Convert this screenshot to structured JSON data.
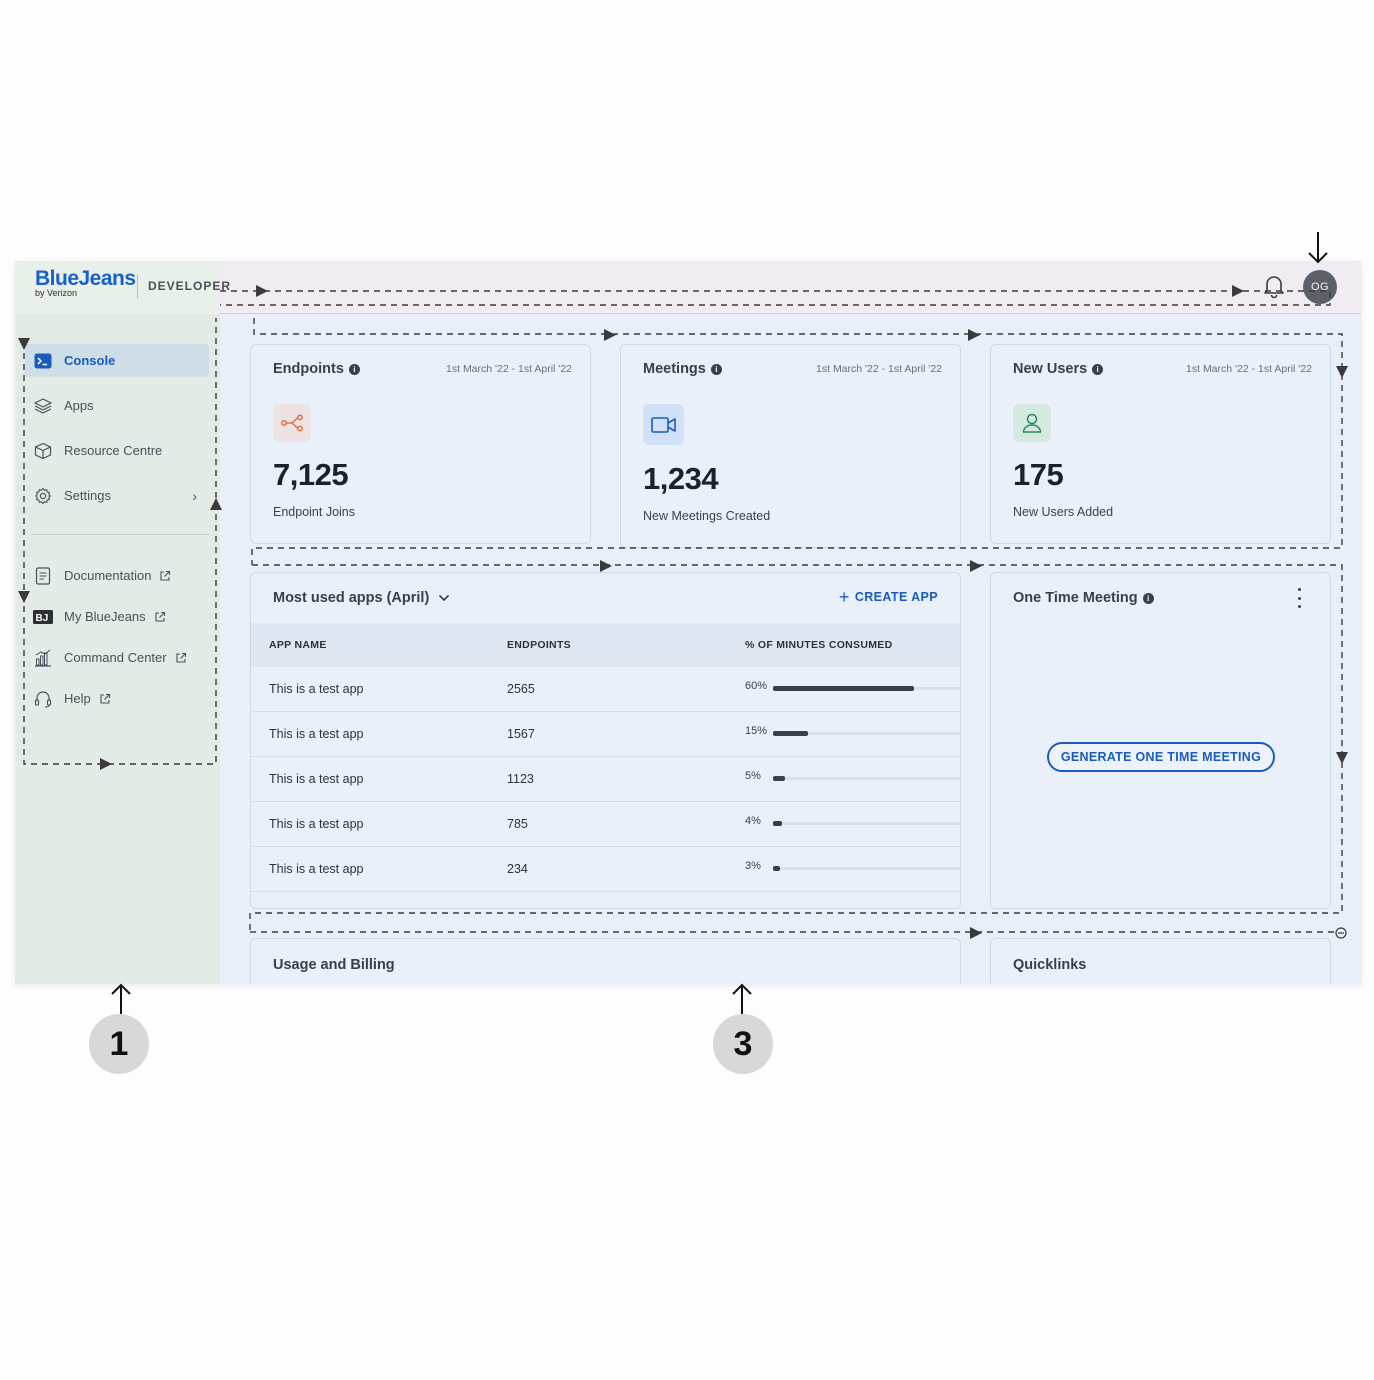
{
  "header": {
    "logo_main": "BlueJeans",
    "logo_sub": "by Verizon",
    "product_tag": "DEVELOPER",
    "avatar_initials": "OG"
  },
  "sidebar": {
    "items": [
      {
        "label": "Console",
        "icon": "console-icon",
        "active": true
      },
      {
        "label": "Apps",
        "icon": "layers-icon"
      },
      {
        "label": "Resource Centre",
        "icon": "box-icon"
      },
      {
        "label": "Settings",
        "icon": "gear-icon",
        "chevron": true
      }
    ],
    "links": [
      {
        "label": "Documentation",
        "icon": "document-icon"
      },
      {
        "label": "My BlueJeans",
        "icon": "bluejeans-logo-icon"
      },
      {
        "label": "Command Center",
        "icon": "bar-chart-icon"
      },
      {
        "label": "Help",
        "icon": "headset-icon"
      }
    ]
  },
  "stats": [
    {
      "title": "Endpoints",
      "range": "1st March '22 - 1st April '22",
      "value": "7,125",
      "sub": "Endpoint Joins",
      "icon": "share-nodes-icon",
      "icon_color": "#e0662d",
      "icon_bg": "#ede2e2"
    },
    {
      "title": "Meetings",
      "range": "1st March '22 - 1st April '22",
      "value": "1,234",
      "sub": "New Meetings Created",
      "icon": "video-camera-icon",
      "icon_color": "#1a5bbf",
      "icon_bg": "#cfe0f7"
    },
    {
      "title": "New Users",
      "range": "1st March '22 - 1st April '22",
      "value": "175",
      "sub": "New Users Added",
      "icon": "user-icon",
      "icon_color": "#2b8a57",
      "icon_bg": "#d5e9e0"
    }
  ],
  "apps_panel": {
    "title": "Most used apps (April)",
    "create_label": "CREATE APP",
    "columns": [
      "APP NAME",
      "ENDPOINTS",
      "% OF MINUTES CONSUMED"
    ],
    "rows": [
      {
        "name": "This is a test app",
        "endpoints": "2565",
        "pct_label": "60%",
        "pct": 60
      },
      {
        "name": "This is a test app",
        "endpoints": "1567",
        "pct_label": "15%",
        "pct": 15
      },
      {
        "name": "This is a test app",
        "endpoints": "1123",
        "pct_label": "5%",
        "pct": 5
      },
      {
        "name": "This is a test app",
        "endpoints": "785",
        "pct_label": "4%",
        "pct": 4
      },
      {
        "name": "This is a test app",
        "endpoints": "234",
        "pct_label": "3%",
        "pct": 3
      }
    ]
  },
  "meeting_panel": {
    "title": "One Time Meeting",
    "button_label": "GENERATE ONE TIME MEETING"
  },
  "bottom_panels": {
    "usage_title": "Usage and Billing",
    "quicklinks_title": "Quicklinks"
  },
  "annotations": {
    "badge_1": "1",
    "badge_3": "3"
  },
  "colors": {
    "accent": "#1a5bbf",
    "header_bg": "#f1ebf2",
    "sidebar_bg": "#e2ebe5",
    "content_bg": "#e8eff8"
  }
}
